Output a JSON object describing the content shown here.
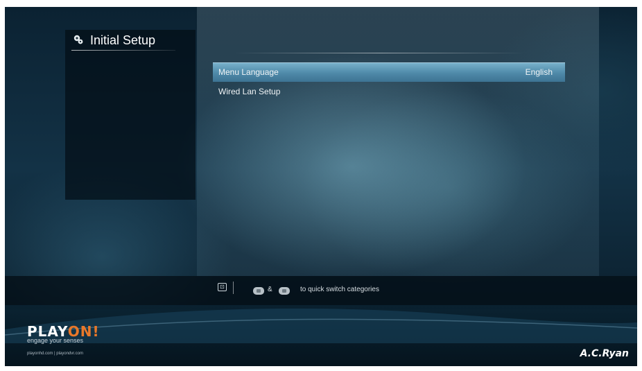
{
  "screen": {
    "title": "Initial Setup",
    "title_icon": "gear-icon"
  },
  "menu": {
    "items": [
      {
        "label": "Menu Language",
        "value": "English",
        "selected": true
      },
      {
        "label": "Wired Lan Setup",
        "value": "",
        "selected": false
      }
    ]
  },
  "hint": {
    "key_icon": "remote-key-icon",
    "amp": "&",
    "text": "to quick switch categories"
  },
  "branding": {
    "logo_main": "PLAY",
    "logo_accent": "ON!",
    "tagline": "engage your senses",
    "links": "playonhd.com | playondvr.com",
    "manufacturer": "A.C.Ryan",
    "accent_color": "#e8782a",
    "highlight_color": "#5b95b4"
  }
}
